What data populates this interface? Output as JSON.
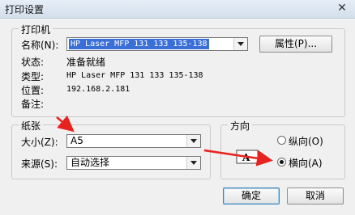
{
  "window": {
    "title": "打印设置",
    "close_glyph": "✕"
  },
  "printer": {
    "group_label": "打印机",
    "name_label": "名称(N):",
    "name_value": "HP Laser MFP 131 133 135-138",
    "properties_button": "属性(P)...",
    "status_label": "状态:",
    "status_value": "准备就绪",
    "type_label": "类型:",
    "type_value": "HP Laser MFP 131 133 135-138",
    "location_label": "位置:",
    "location_value": "192.168.2.181",
    "comment_label": "备注:",
    "comment_value": ""
  },
  "paper": {
    "group_label": "纸张",
    "size_label": "大小(Z):",
    "size_value": "A5",
    "source_label": "来源(S):",
    "source_value": "自动选择"
  },
  "orientation": {
    "group_label": "方向",
    "portrait_label": "纵向(O)",
    "landscape_label": "横向(A)",
    "selected": "landscape",
    "icon_letter": "A"
  },
  "buttons": {
    "ok": "确定",
    "cancel": "取消"
  },
  "colors": {
    "annotation_arrow": "#e8231f",
    "selection": "#3a6fd8"
  }
}
